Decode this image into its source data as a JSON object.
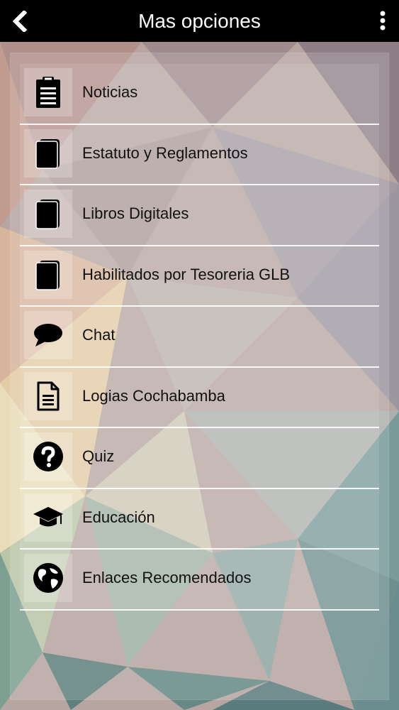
{
  "header": {
    "title": "Mas opciones",
    "back_icon": "chevron-left-icon",
    "more_icon": "vertical-dots-icon"
  },
  "menu": {
    "items": [
      {
        "label": "Noticias",
        "icon": "clipboard-icon"
      },
      {
        "label": "Estatuto y Reglamentos",
        "icon": "book-icon"
      },
      {
        "label": "Libros Digitales",
        "icon": "book-icon"
      },
      {
        "label": "Habilitados por Tesoreria GLB",
        "icon": "book-icon"
      },
      {
        "label": "Chat",
        "icon": "chat-bubble-icon"
      },
      {
        "label": "Logias Cochabamba",
        "icon": "document-icon"
      },
      {
        "label": "Quiz",
        "icon": "question-circle-icon"
      },
      {
        "label": "Educación",
        "icon": "graduation-cap-icon"
      },
      {
        "label": "Enlaces Recomendados",
        "icon": "globe-icon"
      }
    ]
  },
  "colors": {
    "topbar": "#000000",
    "text": "#111111",
    "divider": "#ffffff"
  }
}
